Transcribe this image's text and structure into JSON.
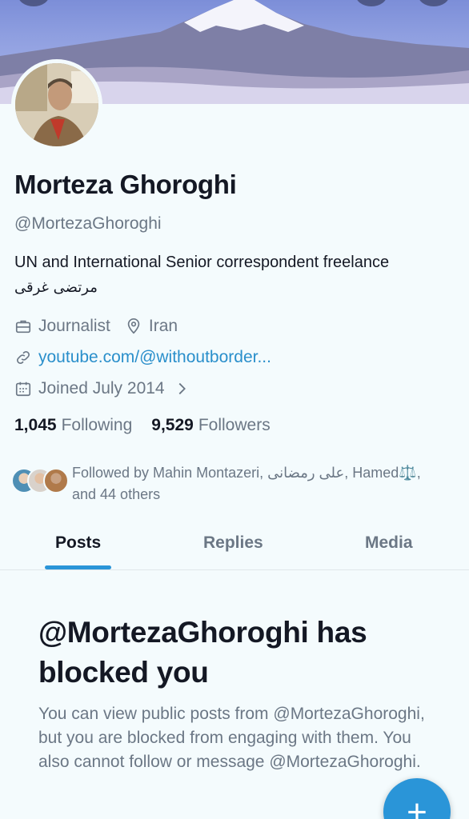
{
  "profile": {
    "name": "Morteza Ghoroghi",
    "handle": "@MortezaGhoroghi",
    "bio_line1": "UN and International Senior correspondent freelance",
    "bio_line2": "مرتضی غرقی",
    "profession": "Journalist",
    "location": "Iran",
    "website": "youtube.com/@withoutborder...",
    "joined": "Joined July 2014",
    "following_count": "1,045",
    "following_label": "Following",
    "followers_count": "9,529",
    "followers_label": "Followers",
    "followed_by_line1": "Followed by Mahin Montazeri, علی رمضانی, Hamed⚖️,",
    "followed_by_line2": "and 44 others"
  },
  "tabs": [
    {
      "label": "Posts",
      "active": true
    },
    {
      "label": "Replies",
      "active": false
    },
    {
      "label": "Media",
      "active": false
    }
  ],
  "blocked": {
    "title": "@MortezaGhoroghi has blocked you",
    "description": "You can view public posts from @MortezaGhoroghi, but you are blocked from engaging with them. You also cannot follow or message @MortezaGhoroghi."
  },
  "fab": {
    "symbol": "+",
    "icon": "compose-plus-icon"
  },
  "colors": {
    "accent": "#2a95d8",
    "link": "#2a8fcb",
    "muted": "#6b7785",
    "background": "#f4fbfd"
  }
}
